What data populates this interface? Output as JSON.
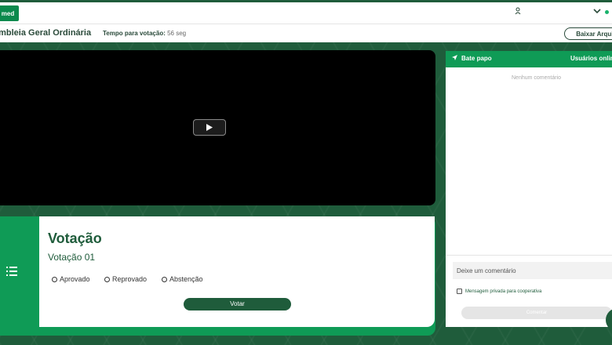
{
  "header": {
    "logo_text": "med",
    "online_color": "#19b36b"
  },
  "titlebar": {
    "title": "embleia Geral Ordinária",
    "timer_label": "Tempo para votação:",
    "timer_value": "56 seg",
    "download_label": "Baixar Arquivo"
  },
  "video": {
    "play_icon": "play-icon"
  },
  "voting": {
    "heading": "Votação",
    "subheading": "Votação 01",
    "options": [
      "Aprovado",
      "Reprovado",
      "Abstenção"
    ],
    "vote_button": "Votar",
    "accent": "#0f9b56"
  },
  "chat": {
    "title": "Bate papo",
    "online_tab": "Usuários online",
    "empty_text": "Nenhum comentário",
    "input_placeholder": "Deixe um comentário",
    "private_label": "Mensagem privada para cooperativa",
    "submit_label": "Comentar"
  }
}
